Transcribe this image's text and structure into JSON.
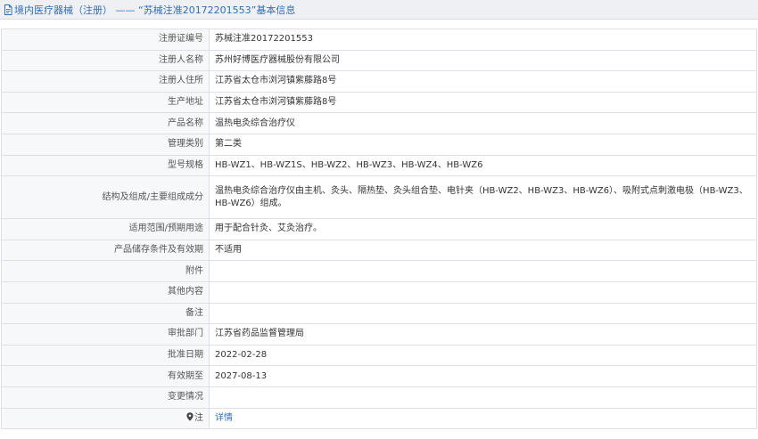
{
  "header": {
    "title": "境内医疗器械（注册） —— “苏械注准20172201553”基本信息",
    "icon": "document-icon"
  },
  "rows": [
    {
      "label": "注册证编号",
      "value": "苏械注准20172201553"
    },
    {
      "label": "注册人名称",
      "value": "苏州好博医疗器械股份有限公司"
    },
    {
      "label": "注册人住所",
      "value": "江苏省太仓市浏河镇紫藤路8号"
    },
    {
      "label": "生产地址",
      "value": "江苏省太仓市浏河镇紫藤路8号"
    },
    {
      "label": "产品名称",
      "value": "温热电灸综合治疗仪"
    },
    {
      "label": "管理类别",
      "value": "第二类"
    },
    {
      "label": "型号规格",
      "value": "HB-WZ1、HB-WZ1S、HB-WZ2、HB-WZ3、HB-WZ4、HB-WZ6"
    },
    {
      "label": "结构及组成/主要组成成分",
      "value": "温热电灸综合治疗仪由主机、灸头、隔热垫、灸头组合垫、电针夹（HB-WZ2、HB-WZ3、HB-WZ6）、吸附式点刺激电极（HB-WZ3、HB-WZ6）组成。"
    },
    {
      "label": "适用范围/预期用途",
      "value": "用于配合针灸、艾灸治疗。"
    },
    {
      "label": "产品储存条件及有效期",
      "value": "不适用"
    },
    {
      "label": "附件",
      "value": ""
    },
    {
      "label": "其他内容",
      "value": ""
    },
    {
      "label": "备注",
      "value": ""
    },
    {
      "label": "审批部门",
      "value": "江苏省药品监督管理局"
    },
    {
      "label": "批准日期",
      "value": "2022-02-28"
    },
    {
      "label": "有效期至",
      "value": "2027-08-13"
    },
    {
      "label": "变更情况",
      "value": ""
    }
  ],
  "footer_row": {
    "label": "注",
    "icon": "location-pin-icon",
    "link_text": "详情"
  }
}
